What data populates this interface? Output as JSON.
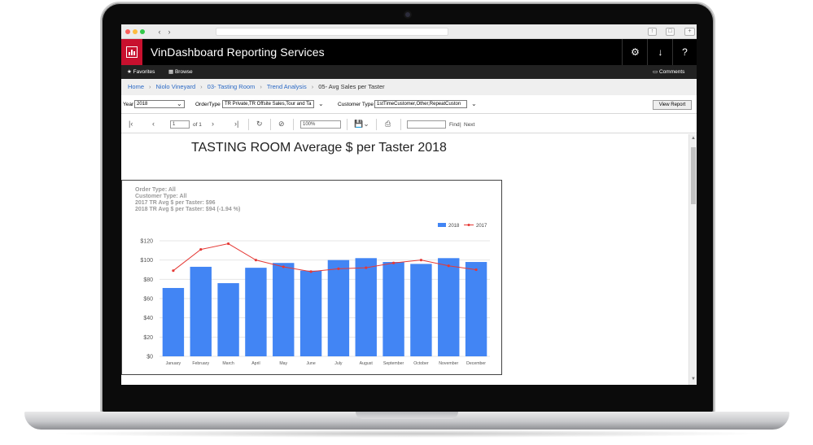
{
  "app": {
    "title": "VinDashboard Reporting Services"
  },
  "header_icons": [
    "gear-icon",
    "download-icon",
    "help-icon"
  ],
  "header_labels": {
    "help": "?"
  },
  "toolbar": {
    "favorites": "Favorites",
    "browse": "Browse",
    "comments": "Comments"
  },
  "breadcrumb": [
    "Home",
    "Niolo Vineyard",
    "03- Tasting Room",
    "Trend Analysis",
    "05- Avg Sales per Taster"
  ],
  "params": {
    "year_label": "Year",
    "year_value": "2018",
    "ordertype_label": "OrderType",
    "ordertype_value": "TR Private,TR Offsite Sales,Tour and Ta",
    "customertype_label": "Customer Type",
    "customertype_value": "1stTimeCustomer,Other,RepeatCuston",
    "view_report": "View Report"
  },
  "report_toolbar": {
    "page": "1",
    "of": "of 1",
    "zoom": "100%",
    "find": "Find",
    "find_sep": "|",
    "next": "Next"
  },
  "report": {
    "title": "TASTING ROOM Average $ per Taster 2018",
    "info_lines": [
      "Order Type: All",
      "Customer Type: All",
      "2017 TR Avg $ per Taster: $96",
      "2018 TR Avg $ per Taster: $94 (-1.94 %)"
    ]
  },
  "colors": {
    "bar": "#4285f4",
    "line": "#e53935",
    "brand": "#c8102e"
  },
  "chart_data": {
    "type": "bar",
    "categories": [
      "January",
      "February",
      "March",
      "April",
      "May",
      "June",
      "July",
      "August",
      "September",
      "October",
      "November",
      "December"
    ],
    "series": [
      {
        "name": "2018",
        "type": "bar",
        "values": [
          71,
          93,
          76,
          92,
          97,
          89,
          100,
          102,
          98,
          96,
          102,
          98
        ]
      },
      {
        "name": "2017",
        "type": "line",
        "values": [
          89,
          111,
          117,
          100,
          93,
          88,
          91,
          92,
          97,
          100,
          94,
          90
        ]
      }
    ],
    "yticks": [
      "$0",
      "$20",
      "$40",
      "$60",
      "$80",
      "$100",
      "$120"
    ],
    "ylim": [
      0,
      120
    ],
    "legend": "top-right",
    "grid": true
  }
}
